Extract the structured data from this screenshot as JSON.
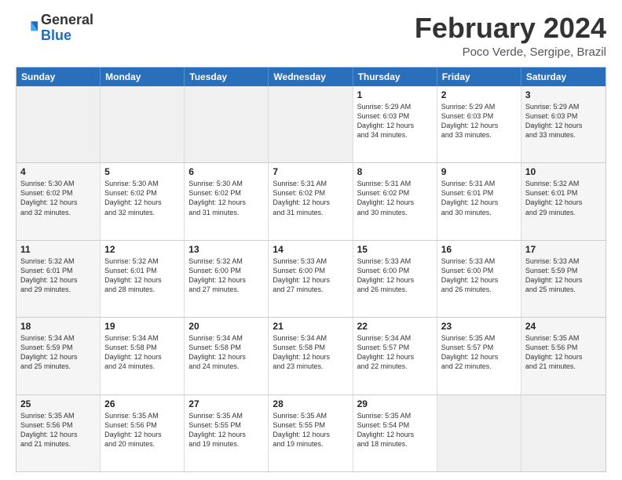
{
  "logo": {
    "general": "General",
    "blue": "Blue"
  },
  "title": "February 2024",
  "subtitle": "Poco Verde, Sergipe, Brazil",
  "headers": [
    "Sunday",
    "Monday",
    "Tuesday",
    "Wednesday",
    "Thursday",
    "Friday",
    "Saturday"
  ],
  "rows": [
    [
      {
        "day": "",
        "lines": [],
        "empty": true
      },
      {
        "day": "",
        "lines": [],
        "empty": true
      },
      {
        "day": "",
        "lines": [],
        "empty": true
      },
      {
        "day": "",
        "lines": [],
        "empty": true
      },
      {
        "day": "1",
        "lines": [
          "Sunrise: 5:29 AM",
          "Sunset: 6:03 PM",
          "Daylight: 12 hours",
          "and 34 minutes."
        ]
      },
      {
        "day": "2",
        "lines": [
          "Sunrise: 5:29 AM",
          "Sunset: 6:03 PM",
          "Daylight: 12 hours",
          "and 33 minutes."
        ]
      },
      {
        "day": "3",
        "lines": [
          "Sunrise: 5:29 AM",
          "Sunset: 6:03 PM",
          "Daylight: 12 hours",
          "and 33 minutes."
        ]
      }
    ],
    [
      {
        "day": "4",
        "lines": [
          "Sunrise: 5:30 AM",
          "Sunset: 6:02 PM",
          "Daylight: 12 hours",
          "and 32 minutes."
        ]
      },
      {
        "day": "5",
        "lines": [
          "Sunrise: 5:30 AM",
          "Sunset: 6:02 PM",
          "Daylight: 12 hours",
          "and 32 minutes."
        ]
      },
      {
        "day": "6",
        "lines": [
          "Sunrise: 5:30 AM",
          "Sunset: 6:02 PM",
          "Daylight: 12 hours",
          "and 31 minutes."
        ]
      },
      {
        "day": "7",
        "lines": [
          "Sunrise: 5:31 AM",
          "Sunset: 6:02 PM",
          "Daylight: 12 hours",
          "and 31 minutes."
        ]
      },
      {
        "day": "8",
        "lines": [
          "Sunrise: 5:31 AM",
          "Sunset: 6:02 PM",
          "Daylight: 12 hours",
          "and 30 minutes."
        ]
      },
      {
        "day": "9",
        "lines": [
          "Sunrise: 5:31 AM",
          "Sunset: 6:01 PM",
          "Daylight: 12 hours",
          "and 30 minutes."
        ]
      },
      {
        "day": "10",
        "lines": [
          "Sunrise: 5:32 AM",
          "Sunset: 6:01 PM",
          "Daylight: 12 hours",
          "and 29 minutes."
        ]
      }
    ],
    [
      {
        "day": "11",
        "lines": [
          "Sunrise: 5:32 AM",
          "Sunset: 6:01 PM",
          "Daylight: 12 hours",
          "and 29 minutes."
        ]
      },
      {
        "day": "12",
        "lines": [
          "Sunrise: 5:32 AM",
          "Sunset: 6:01 PM",
          "Daylight: 12 hours",
          "and 28 minutes."
        ]
      },
      {
        "day": "13",
        "lines": [
          "Sunrise: 5:32 AM",
          "Sunset: 6:00 PM",
          "Daylight: 12 hours",
          "and 27 minutes."
        ]
      },
      {
        "day": "14",
        "lines": [
          "Sunrise: 5:33 AM",
          "Sunset: 6:00 PM",
          "Daylight: 12 hours",
          "and 27 minutes."
        ]
      },
      {
        "day": "15",
        "lines": [
          "Sunrise: 5:33 AM",
          "Sunset: 6:00 PM",
          "Daylight: 12 hours",
          "and 26 minutes."
        ]
      },
      {
        "day": "16",
        "lines": [
          "Sunrise: 5:33 AM",
          "Sunset: 6:00 PM",
          "Daylight: 12 hours",
          "and 26 minutes."
        ]
      },
      {
        "day": "17",
        "lines": [
          "Sunrise: 5:33 AM",
          "Sunset: 5:59 PM",
          "Daylight: 12 hours",
          "and 25 minutes."
        ]
      }
    ],
    [
      {
        "day": "18",
        "lines": [
          "Sunrise: 5:34 AM",
          "Sunset: 5:59 PM",
          "Daylight: 12 hours",
          "and 25 minutes."
        ]
      },
      {
        "day": "19",
        "lines": [
          "Sunrise: 5:34 AM",
          "Sunset: 5:58 PM",
          "Daylight: 12 hours",
          "and 24 minutes."
        ]
      },
      {
        "day": "20",
        "lines": [
          "Sunrise: 5:34 AM",
          "Sunset: 5:58 PM",
          "Daylight: 12 hours",
          "and 24 minutes."
        ]
      },
      {
        "day": "21",
        "lines": [
          "Sunrise: 5:34 AM",
          "Sunset: 5:58 PM",
          "Daylight: 12 hours",
          "and 23 minutes."
        ]
      },
      {
        "day": "22",
        "lines": [
          "Sunrise: 5:34 AM",
          "Sunset: 5:57 PM",
          "Daylight: 12 hours",
          "and 22 minutes."
        ]
      },
      {
        "day": "23",
        "lines": [
          "Sunrise: 5:35 AM",
          "Sunset: 5:57 PM",
          "Daylight: 12 hours",
          "and 22 minutes."
        ]
      },
      {
        "day": "24",
        "lines": [
          "Sunrise: 5:35 AM",
          "Sunset: 5:56 PM",
          "Daylight: 12 hours",
          "and 21 minutes."
        ]
      }
    ],
    [
      {
        "day": "25",
        "lines": [
          "Sunrise: 5:35 AM",
          "Sunset: 5:56 PM",
          "Daylight: 12 hours",
          "and 21 minutes."
        ]
      },
      {
        "day": "26",
        "lines": [
          "Sunrise: 5:35 AM",
          "Sunset: 5:56 PM",
          "Daylight: 12 hours",
          "and 20 minutes."
        ]
      },
      {
        "day": "27",
        "lines": [
          "Sunrise: 5:35 AM",
          "Sunset: 5:55 PM",
          "Daylight: 12 hours",
          "and 19 minutes."
        ]
      },
      {
        "day": "28",
        "lines": [
          "Sunrise: 5:35 AM",
          "Sunset: 5:55 PM",
          "Daylight: 12 hours",
          "and 19 minutes."
        ]
      },
      {
        "day": "29",
        "lines": [
          "Sunrise: 5:35 AM",
          "Sunset: 5:54 PM",
          "Daylight: 12 hours",
          "and 18 minutes."
        ]
      },
      {
        "day": "",
        "lines": [],
        "empty": true
      },
      {
        "day": "",
        "lines": [],
        "empty": true
      }
    ]
  ]
}
